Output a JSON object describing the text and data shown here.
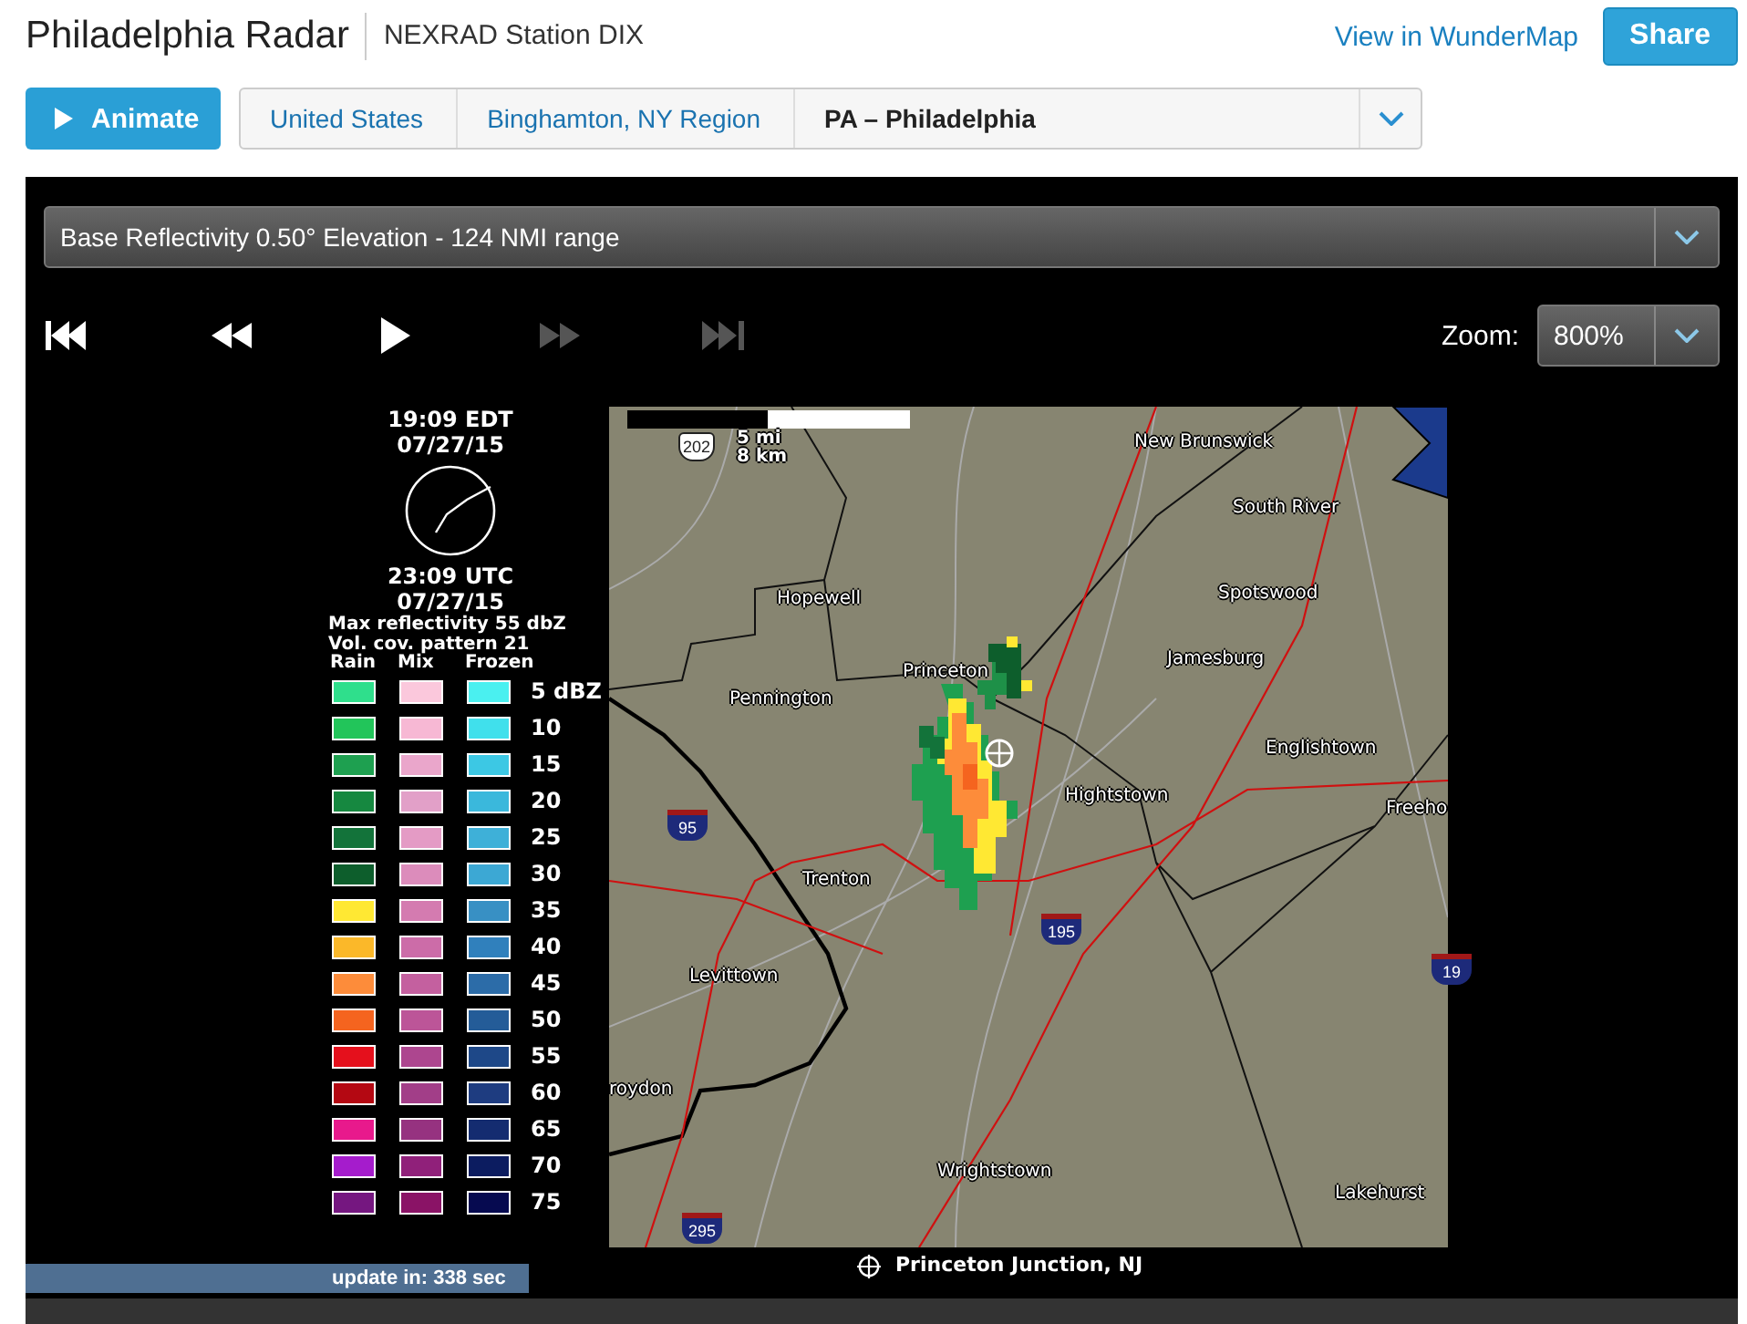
{
  "header": {
    "title": "Philadelphia Radar",
    "station": "NEXRAD Station DIX",
    "map_link": "View in WunderMap",
    "share_button": "Share"
  },
  "animate_button": "Animate",
  "breadcrumbs": [
    {
      "label": "United States",
      "selected": false
    },
    {
      "label": "Binghamton, NY Region",
      "selected": false
    },
    {
      "label": "PA – Philadelphia",
      "selected": true
    }
  ],
  "product_select": {
    "value": "Base Reflectivity 0.50° Elevation - 124 NMI range"
  },
  "playback": [
    {
      "kind": "first",
      "disabled": false
    },
    {
      "kind": "rewind",
      "disabled": false
    },
    {
      "kind": "play",
      "disabled": false
    },
    {
      "kind": "forward",
      "disabled": true
    },
    {
      "kind": "last",
      "disabled": true
    }
  ],
  "zoom": {
    "label": "Zoom:",
    "value": "800%"
  },
  "legend": {
    "local_time": "19:09 EDT",
    "local_date": "07/27/15",
    "utc_time": "23:09 UTC",
    "utc_date": "07/27/15",
    "max_reflectivity": "Max reflectivity 55 dbZ",
    "vcp": "Vol. cov. pattern 21",
    "columns": [
      "Rain",
      "Mix",
      "Frozen"
    ],
    "rows": [
      {
        "value": "5 dBZ",
        "swatches": [
          {
            "color": "#2fdf8c"
          },
          {
            "color": "#fbc8dc"
          },
          {
            "color": "#4af0f0"
          }
        ]
      },
      {
        "value": "10",
        "swatches": [
          {
            "color": "#22c55a"
          },
          {
            "color": "#f7b8d4"
          },
          {
            "color": "#40e0ec"
          }
        ]
      },
      {
        "value": "15",
        "swatches": [
          {
            "color": "#1ea050"
          },
          {
            "color": "#eaa6cb"
          },
          {
            "color": "#3cc8e4"
          }
        ]
      },
      {
        "value": "20",
        "swatches": [
          {
            "color": "#168840"
          },
          {
            "color": "#e2a0c8"
          },
          {
            "color": "#3ab8dc"
          }
        ]
      },
      {
        "value": "25",
        "swatches": [
          {
            "color": "#13733a"
          },
          {
            "color": "#e49bc5"
          },
          {
            "color": "#3eb0d8"
          }
        ]
      },
      {
        "value": "30",
        "swatches": [
          {
            "color": "#0d5e2c"
          },
          {
            "color": "#dc8cbb"
          },
          {
            "color": "#3ca8d4"
          }
        ]
      },
      {
        "value": "35",
        "swatches": [
          {
            "color": "#ffe833"
          },
          {
            "color": "#d47bb0"
          },
          {
            "color": "#3890c4"
          }
        ]
      },
      {
        "value": "40",
        "swatches": [
          {
            "color": "#fbb829"
          },
          {
            "color": "#cc6ca8"
          },
          {
            "color": "#3080bc"
          }
        ]
      },
      {
        "value": "45",
        "swatches": [
          {
            "color": "#fd8c3a"
          },
          {
            "color": "#c4609f"
          },
          {
            "color": "#2c6ca8"
          }
        ]
      },
      {
        "value": "50",
        "swatches": [
          {
            "color": "#f5641f"
          },
          {
            "color": "#bc5598"
          },
          {
            "color": "#245c98"
          }
        ]
      },
      {
        "value": "55",
        "swatches": [
          {
            "color": "#e5101c"
          },
          {
            "color": "#ad468f"
          },
          {
            "color": "#1e4888"
          }
        ]
      },
      {
        "value": "60",
        "swatches": [
          {
            "color": "#b40812"
          },
          {
            "color": "#a23e88"
          },
          {
            "color": "#1e3c80"
          }
        ]
      },
      {
        "value": "65",
        "swatches": [
          {
            "color": "#e8198c"
          },
          {
            "color": "#963280"
          },
          {
            "color": "#142c70"
          }
        ]
      },
      {
        "value": "70",
        "swatches": [
          {
            "color": "#a51ccc"
          },
          {
            "color": "#90207a"
          },
          {
            "color": "#0c1c60"
          }
        ]
      },
      {
        "value": "75",
        "swatches": [
          {
            "color": "#751780"
          },
          {
            "color": "#8a1366"
          },
          {
            "color": "#060a50"
          }
        ]
      }
    ]
  },
  "map": {
    "scale_miles": "5 mi",
    "scale_km": "8 km",
    "shields": [
      "202",
      "95",
      "195",
      "295",
      "19"
    ],
    "places": [
      "New Brunswick",
      "South River",
      "Spotswood",
      "Jamesburg",
      "Englishtown",
      "Freeho",
      "Hopewell",
      "Princeton",
      "Pennington",
      "Hightstown",
      "Trenton",
      "Levittown",
      "roydon",
      "Wrightstown",
      "Lakehurst"
    ]
  },
  "location": "Princeton Junction, NJ",
  "update": "update in: 338 sec"
}
